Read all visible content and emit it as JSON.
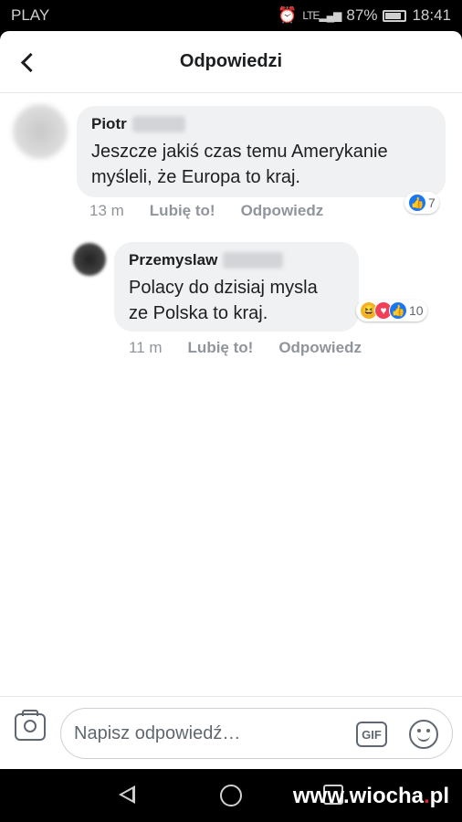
{
  "status": {
    "carrier": "PLAY",
    "lte": "LTE",
    "battery": "87%",
    "time": "18:41"
  },
  "header": {
    "title": "Odpowiedzi",
    "back_icon": "chevron-left-icon"
  },
  "comments": [
    {
      "author": "Piotr",
      "text_line1": "Jeszcze jakiś czas temu Amerykanie",
      "text_line2": "myśleli, że Europa to kraj.",
      "time": "13 m",
      "like_label": "Lubię to!",
      "reply_label": "Odpowiedz",
      "reaction_count": "7",
      "reaction_icons": [
        "like-icon"
      ]
    },
    {
      "author": "Przemyslaw",
      "text_line1": "Polacy do dzisiaj mysla",
      "text_line2": "ze Polska to kraj.",
      "time": "11 m",
      "like_label": "Lubię to!",
      "reply_label": "Odpowiedz",
      "reaction_count": "10",
      "reaction_icons": [
        "haha-icon",
        "love-icon",
        "like-icon"
      ]
    }
  ],
  "composer": {
    "placeholder": "Napisz odpowiedź…",
    "gif_label": "GIF"
  },
  "watermark": {
    "left": "www.wiocha",
    "dot": ".",
    "right": "pl"
  },
  "colors": {
    "accent": "#1877f2",
    "bubble": "#f0f1f3",
    "meta": "#90949c"
  }
}
